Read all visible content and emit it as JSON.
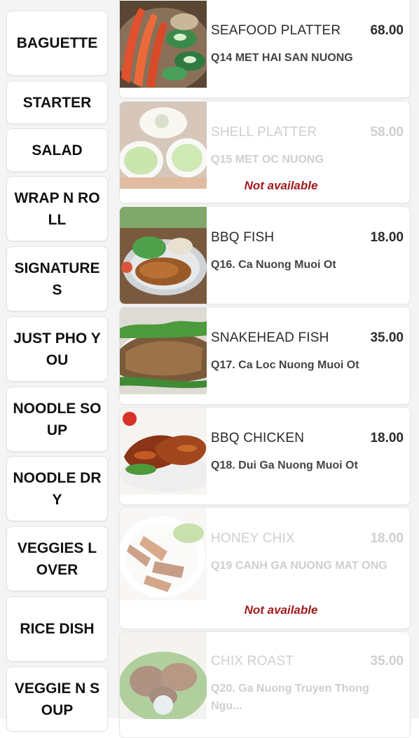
{
  "categories": [
    {
      "label": "BAGUETTE"
    },
    {
      "label": "STARTER"
    },
    {
      "label": "SALAD"
    },
    {
      "label": "WRAP N ROLL"
    },
    {
      "label": "SIGNATURES"
    },
    {
      "label": "JUST PHO YOU"
    },
    {
      "label": "NOODLE SOUP"
    },
    {
      "label": "NOODLE DRY"
    },
    {
      "label": "VEGGIES LOVER"
    },
    {
      "label": "RICE DISH"
    },
    {
      "label": "VEGGIE N SOUP"
    }
  ],
  "items": [
    {
      "name": "SEAFOOD PLATTER",
      "price": "68.00",
      "subtitle": "Q14 MET HAI SAN NUONG",
      "status": "",
      "image": "seafood-platter-photo"
    },
    {
      "name": "SHELL PLATTER",
      "price": "58.00",
      "subtitle": "Q15 MET OC NUONG",
      "status": "Not available",
      "image": "shell-platter-photo"
    },
    {
      "name": "BBQ FISH",
      "price": "18.00",
      "subtitle": "Q16. Ca Nuong Muoi Ot",
      "status": "",
      "image": "bbq-fish-photo"
    },
    {
      "name": "SNAKEHEAD FISH",
      "price": "35.00",
      "subtitle": "Q17. Ca Loc Nuong Muoi Ot",
      "status": "",
      "image": "snakehead-fish-photo"
    },
    {
      "name": "BBQ CHICKEN",
      "price": "18.00",
      "subtitle": "Q18. Dui Ga Nuong Muoi Ot",
      "status": "",
      "image": "bbq-chicken-photo"
    },
    {
      "name": "HONEY CHIX",
      "price": "18.00",
      "subtitle": "Q19 CANH GA NUONG MAT ONG",
      "status": "Not available",
      "image": "honey-chix-photo"
    },
    {
      "name": "CHIX ROAST",
      "price": "35.00",
      "subtitle": "Q20. Ga Nuong Truyen Thong Ngu...",
      "status": "",
      "image": "chix-roast-photo"
    }
  ],
  "colors": {
    "unavailable_text": "#a01b1b",
    "muted_text": "#cfcfcf"
  }
}
